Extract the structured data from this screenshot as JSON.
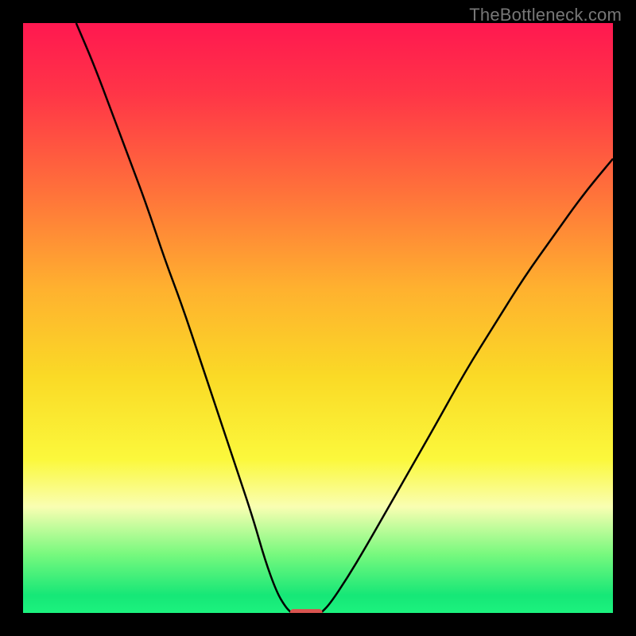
{
  "watermark": "TheBottleneck.com",
  "chart_data": {
    "type": "line",
    "title": "",
    "xlabel": "",
    "ylabel": "",
    "xlim": [
      0,
      100
    ],
    "ylim": [
      0,
      100
    ],
    "grid": false,
    "background_gradient": {
      "stops": [
        {
          "offset": 0.0,
          "color": "#ff1850"
        },
        {
          "offset": 0.12,
          "color": "#ff3547"
        },
        {
          "offset": 0.28,
          "color": "#ff6f3b"
        },
        {
          "offset": 0.45,
          "color": "#ffb12f"
        },
        {
          "offset": 0.6,
          "color": "#fada26"
        },
        {
          "offset": 0.74,
          "color": "#fbf83c"
        },
        {
          "offset": 0.82,
          "color": "#f9feb2"
        },
        {
          "offset": 0.9,
          "color": "#78f97e"
        },
        {
          "offset": 0.97,
          "color": "#16e777"
        },
        {
          "offset": 1.0,
          "color": "#1cf27e"
        }
      ]
    },
    "series": [
      {
        "name": "left-curve",
        "color": "#000000",
        "x": [
          9,
          12,
          15,
          18,
          21,
          24,
          27,
          30,
          33,
          36,
          39,
          41,
          43,
          44.5,
          45.5
        ],
        "y": [
          100,
          93,
          85,
          77,
          69,
          60,
          52,
          43,
          34,
          25,
          16,
          9,
          3.5,
          1,
          0
        ]
      },
      {
        "name": "right-curve",
        "color": "#000000",
        "x": [
          50.5,
          52,
          55,
          58,
          62,
          66,
          70,
          75,
          80,
          85,
          90,
          95,
          100
        ],
        "y": [
          0,
          1.5,
          6,
          11,
          18,
          25,
          32,
          41,
          49,
          57,
          64,
          71,
          77
        ]
      }
    ],
    "marker": {
      "name": "optimum-marker",
      "x": 48,
      "y": 0,
      "width": 5.5,
      "height": 1.3,
      "color": "#d9534f"
    }
  }
}
